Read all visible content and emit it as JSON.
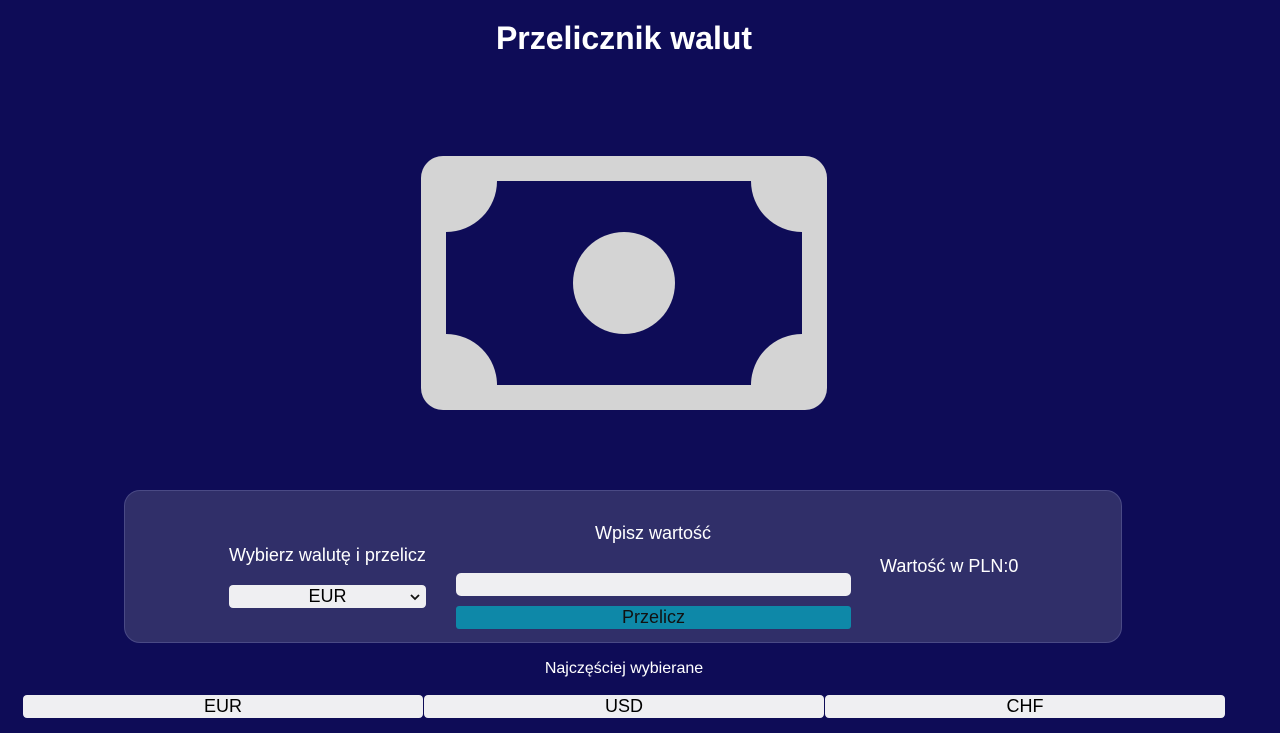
{
  "title": "Przelicznik walut",
  "colors": {
    "background": "#0e0c57",
    "panel": "#302f69",
    "icon": "#d4d4d4",
    "button_accent": "#0e88a8"
  },
  "hero_icon": "money-bill-icon",
  "converter": {
    "currency_label": "Wybierz walutę i przelicz",
    "selected_currency": "EUR",
    "value_label": "Wpisz wartość",
    "value_input": "",
    "calc_button_label": "Przelicz",
    "result_text": "Wartość w PLN:0"
  },
  "favorites": {
    "label": "Najczęściej wybierane",
    "buttons": [
      "EUR",
      "USD",
      "CHF"
    ]
  }
}
